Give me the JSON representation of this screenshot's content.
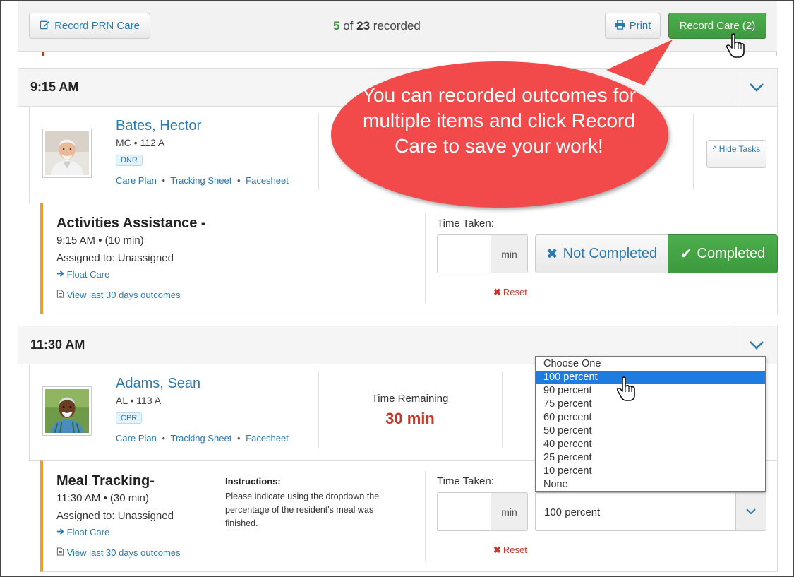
{
  "toolbar": {
    "record_prn_label": "Record PRN Care",
    "recorded_count": "5",
    "recorded_of": "of",
    "recorded_total": "23",
    "recorded_suffix": "recorded",
    "print_label": "Print",
    "record_care_label": "Record Care (2)"
  },
  "callout": {
    "text": "You can recorded outcomes for multiple items and click Record Care to save your work!"
  },
  "sections": [
    {
      "time": "9:15 AM",
      "resident": {
        "name": "Bates, Hector",
        "room_prefix": "MC",
        "room": "112 A",
        "badge": "DNR",
        "links": [
          "Care Plan",
          "Tracking Sheet",
          "Facesheet"
        ],
        "hide_tasks": "Hide Tasks"
      },
      "task": {
        "title": "Activities Assistance -",
        "time": "9:15 AM",
        "duration": "(10 min)",
        "assigned": "Assigned to: Unassigned",
        "float_care": "Float Care",
        "view_outcomes": "View last 30 days outcomes",
        "time_taken_label": "Time Taken:",
        "unit": "min",
        "reset": "Reset",
        "not_completed": "Not Completed",
        "completed": "Completed"
      }
    },
    {
      "time": "11:30 AM",
      "resident": {
        "name": "Adams, Sean",
        "room_prefix": "AL",
        "room": "113 A",
        "badge": "CPR",
        "links": [
          "Care Plan",
          "Tracking Sheet",
          "Facesheet"
        ],
        "time_remaining_label": "Time Remaining",
        "time_remaining_value": "30 min"
      },
      "task": {
        "title": "Meal Tracking-",
        "time": "11:30 AM",
        "duration": "(30 min)",
        "assigned": "Assigned to: Unassigned",
        "float_care": "Float Care",
        "view_outcomes": "View last 30 days outcomes",
        "instructions_title": "Instructions:",
        "instructions_body": "Please indicate using the dropdown the percentage of the resident's meal was finished.",
        "time_taken_label": "Time Taken:",
        "unit": "min",
        "reset": "Reset",
        "selected": "100 percent"
      }
    }
  ],
  "dropdown": {
    "options": [
      "Choose One",
      "100 percent",
      "90 percent",
      "75 percent",
      "60 percent",
      "50 percent",
      "40 percent",
      "25 percent",
      "10 percent",
      "None"
    ],
    "highlighted": "100 percent"
  },
  "colors": {
    "link": "#2a7ab0",
    "success": "#3d9a3d",
    "danger": "#c0392b",
    "callout": "#f24a4a",
    "task_accent": "#f0a020",
    "dropdown_highlight": "#1e7be0"
  },
  "icons": {
    "record_prn": "edit-icon",
    "print": "printer-icon",
    "chevron": "chevron-down-icon",
    "float": "arrow-right-icon",
    "view": "document-icon",
    "not_completed": "times-icon",
    "completed": "check-icon",
    "reset": "times-icon",
    "cursor": "hand-pointer-icon"
  }
}
